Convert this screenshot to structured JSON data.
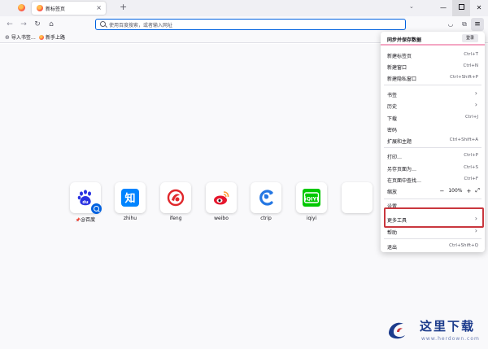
{
  "tab": {
    "title": "新标签页",
    "close": "×"
  },
  "new_tab": "+",
  "tabs_menu": "⌄",
  "window": {
    "minimize": "—",
    "close": "✕"
  },
  "urlbar": {
    "placeholder": "使用百度搜索，或者输入网址"
  },
  "bookmarks": [
    {
      "label": "导入书签…",
      "icon": "import-icon"
    },
    {
      "label": "新手上路",
      "icon": "firefox-icon"
    }
  ],
  "top_sites": [
    {
      "label": "@百度",
      "pin": "📌"
    },
    {
      "label": "zhihu"
    },
    {
      "label": "ifeng"
    },
    {
      "label": "weibo"
    },
    {
      "label": "ctrip"
    },
    {
      "label": "iqiyi"
    },
    {
      "label": ""
    }
  ],
  "menu": {
    "sync_title": "同步并保存数据",
    "login": "登录",
    "new_tab": {
      "label": "新建标签页",
      "shortcut": "Ctrl+T"
    },
    "new_window": {
      "label": "新建窗口",
      "shortcut": "Ctrl+N"
    },
    "new_private": {
      "label": "新建隐私窗口",
      "shortcut": "Ctrl+Shift+P"
    },
    "bookmarks": {
      "label": "书签"
    },
    "history": {
      "label": "历史"
    },
    "downloads": {
      "label": "下载",
      "shortcut": "Ctrl+J"
    },
    "passwords": {
      "label": "密码"
    },
    "addons": {
      "label": "扩展和主题",
      "shortcut": "Ctrl+Shift+A"
    },
    "print": {
      "label": "打印…",
      "shortcut": "Ctrl+P"
    },
    "save_page": {
      "label": "另存页面为…",
      "shortcut": "Ctrl+S"
    },
    "find": {
      "label": "在页面中查找…",
      "shortcut": "Ctrl+F"
    },
    "zoom": {
      "label": "缩放",
      "minus": "−",
      "value": "100%",
      "plus": "+",
      "fullscreen": "⤢"
    },
    "settings": {
      "label": "设置"
    },
    "more_tools": {
      "label": "更多工具"
    },
    "help": {
      "label": "帮助"
    },
    "quit": {
      "label": "退出",
      "shortcut": "Ctrl+Shift+Q"
    }
  },
  "watermark": {
    "text": "这里下载",
    "url": "www.herdown.com"
  }
}
